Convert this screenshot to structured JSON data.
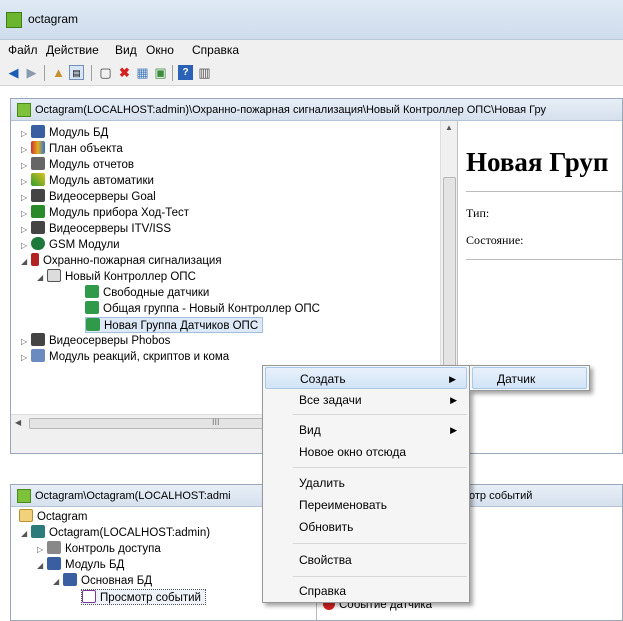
{
  "window": {
    "title": "octagram"
  },
  "menubar": [
    "Файл",
    "Действие",
    "Вид",
    "Окно",
    "Справка"
  ],
  "panel1": {
    "path": "Octagram(LOCALHOST:admin)\\Охранно-пожарная сигнализация\\Новый Контроллер ОПС\\Новая Гру",
    "tree": [
      {
        "label": "Модуль БД",
        "icon": "database-module-icon",
        "arrow": "▷"
      },
      {
        "label": "План объекта",
        "icon": "floor-plan-icon",
        "arrow": "▷"
      },
      {
        "label": "Модуль отчетов",
        "icon": "reports-module-icon",
        "arrow": "▷"
      },
      {
        "label": "Модуль автоматики",
        "icon": "automation-module-icon",
        "arrow": "▷"
      },
      {
        "label": "Видеосерверы Goal",
        "icon": "video-server-icon",
        "arrow": "▷"
      },
      {
        "label": "Модуль прибора Ход-Тест",
        "icon": "device-module-icon",
        "arrow": "▷"
      },
      {
        "label": "Видеосерверы ITV/ISS",
        "icon": "video-server-icon",
        "arrow": "▷"
      },
      {
        "label": "GSM Модули",
        "icon": "gsm-module-icon",
        "arrow": "▷"
      },
      {
        "label": "Охранно-пожарная сигнализация",
        "icon": "fire-alarm-icon",
        "arrow": "◢"
      },
      {
        "label": "Новый Контроллер ОПС",
        "icon": "controller-icon",
        "arrow": "◢"
      },
      {
        "label": "Свободные датчики",
        "icon": "sensor-group-icon",
        "arrow": ""
      },
      {
        "label": "Общая группа - Новый Контроллер ОПС",
        "icon": "sensor-group-icon",
        "arrow": ""
      },
      {
        "label": "Новая Группа Датчиков ОПС",
        "icon": "sensor-group-icon",
        "arrow": ""
      },
      {
        "label": "Видеосерверы Phobos",
        "icon": "video-server-icon",
        "arrow": "▷"
      },
      {
        "label": "Модуль реакций, скриптов и кома",
        "icon": "reactions-module-icon",
        "arrow": "▷"
      }
    ],
    "right": {
      "heading": "Новая Груп",
      "type_label": "Тип:",
      "state_label": "Состояние:"
    },
    "hscroll_mark": "III"
  },
  "panel2": {
    "path": "Octagram\\Octagram(LOCALHOST:admi",
    "right_title": "отр событий",
    "tree": [
      {
        "label": "Octagram",
        "icon": "folder-icon",
        "arrow": ""
      },
      {
        "label": "Octagram(LOCALHOST:admin)",
        "icon": "server-icon",
        "arrow": "◢"
      },
      {
        "label": "Контроль доступа",
        "icon": "access-control-icon",
        "arrow": "▷"
      },
      {
        "label": "Модуль БД",
        "icon": "database-module-icon",
        "arrow": "◢"
      },
      {
        "label": "Основная БД",
        "icon": "database-icon",
        "arrow": "◢"
      },
      {
        "label": "Просмотр событий",
        "icon": "event-viewer-icon",
        "arrow": ""
      }
    ],
    "right_rows": [
      "Событие датчика"
    ]
  },
  "context_menu": {
    "items": [
      {
        "label": "Создать",
        "submenu": true
      },
      {
        "label": "Все задачи",
        "submenu": true
      },
      {
        "label": "Вид",
        "submenu": true
      },
      {
        "label": "Новое окно отсюда",
        "submenu": false
      },
      {
        "label": "Удалить",
        "submenu": false
      },
      {
        "label": "Переименовать",
        "submenu": false
      },
      {
        "label": "Обновить",
        "submenu": false
      },
      {
        "label": "Свойства",
        "submenu": false
      },
      {
        "label": "Справка",
        "submenu": false
      }
    ],
    "submenu_arrow": "▶",
    "submenu": {
      "items": [
        "Датчик"
      ]
    }
  },
  "colors": {
    "selection": "#dde9f7",
    "accent": "#7dc23a",
    "menu_bg": "#f5f5f5"
  }
}
